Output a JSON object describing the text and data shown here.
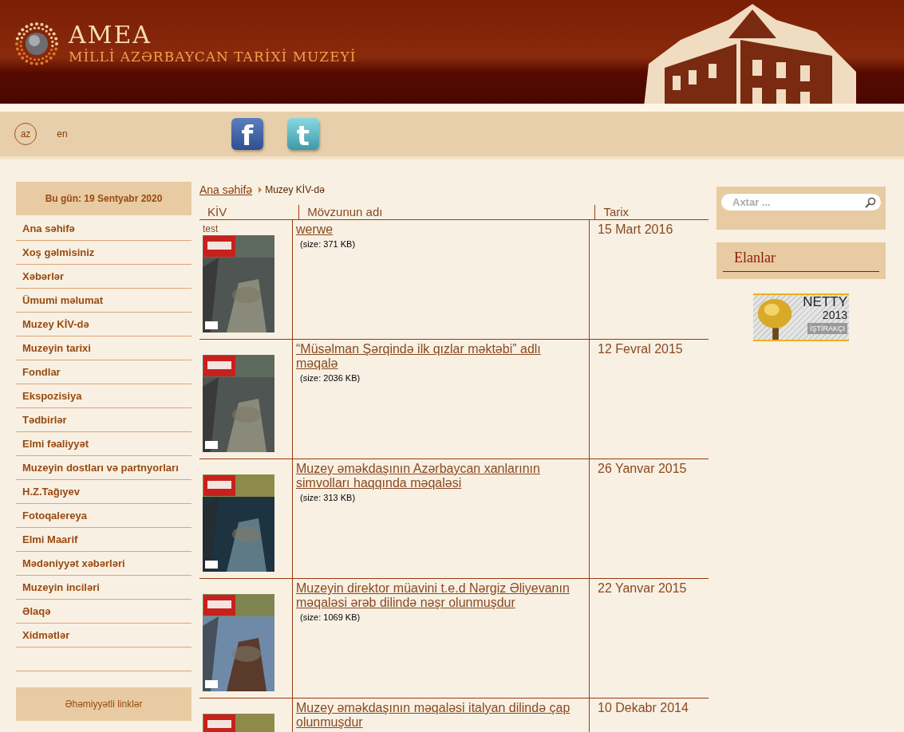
{
  "header": {
    "logo_title": "AMEA",
    "logo_subtitle": "MİLLİ AZƏRBAYCAN TARİXİ MUZEYİ"
  },
  "languages": [
    {
      "label": "az",
      "selected": true
    },
    {
      "label": "en",
      "selected": false
    }
  ],
  "social": [
    {
      "kind": "facebook",
      "glyph": "f"
    },
    {
      "kind": "twitter",
      "glyph": "t"
    }
  ],
  "sidebar": {
    "date": "Bu gün: 19 Sentyabr 2020",
    "items": [
      "Ana səhifə",
      "Xoş gəlmisiniz",
      "Xəbərlər",
      "Ümumi məlumat",
      "Muzey KİV-də",
      "Muzeyin tarixi",
      "Fondlar",
      "Ekspozisiya",
      "Tədbirlər",
      "Elmi fəaliyyət",
      "Muzeyin dostları və partnyorları",
      "H.Z.Tağıyev",
      "Fotoqalereya",
      "Elmi Maarif",
      "Mədəniyyət xəbərləri",
      "Muzeyin inciləri",
      "Əlaqə",
      "Xidmətlər"
    ],
    "links_title": "Əhəmiyyətli linklər"
  },
  "breadcrumb": [
    "Ana səhifə",
    "Muzey KİV-də"
  ],
  "table": {
    "columns": [
      "KİV",
      "Mövzunun adı",
      "Tarix"
    ],
    "rows": [
      {
        "caption": "test",
        "title": "werwe",
        "size": "(size: 371 KB)",
        "date": "15 Mart 2016"
      },
      {
        "title": "“Müsəlman Şərqində ilk qızlar məktəbi” adlı məqalə",
        "size": "(size: 2036 KB)",
        "date": "12 Fevral 2015"
      },
      {
        "title": "Muzey əməkdaşının Azərbaycan xanlarının simvolları haqqında məqaləsi",
        "size": "(size: 313 KB)",
        "date": "26 Yanvar 2015"
      },
      {
        "title": "Muzeyin direktor müavini t.e.d Nərgiz Əliyevanın məqaləsi ərəb dilində nəşr olunmuşdur",
        "size": "(size: 1069 KB)",
        "date": "22 Yanvar 2015"
      },
      {
        "title": "Muzey əməkdaşının məqaləsi italyan dilində çap olunmuşdur",
        "date": "10 Dekabr 2014"
      }
    ]
  },
  "search": {
    "placeholder": "Axtar ..."
  },
  "announcements": {
    "title": "Elanlar"
  },
  "banner": {
    "name": "NETTY",
    "year": "2013",
    "badge": "İŞTİRAKÇI"
  }
}
